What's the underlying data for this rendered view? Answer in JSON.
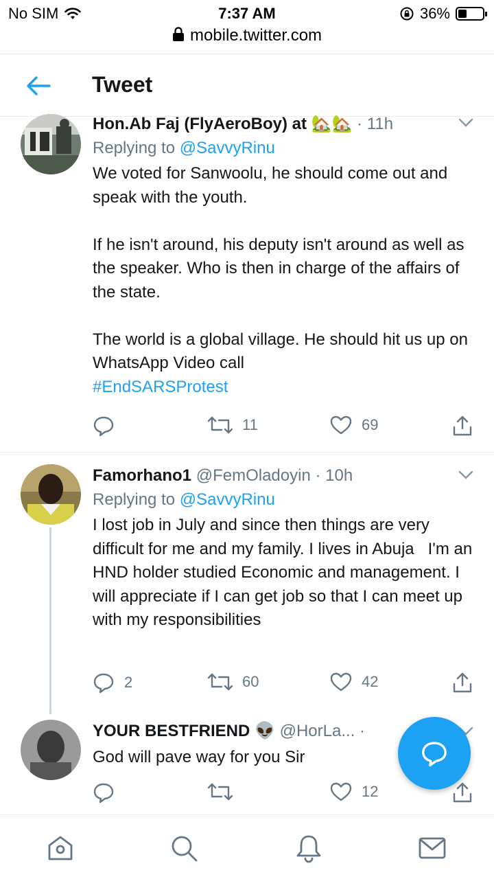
{
  "status_bar": {
    "carrier": "No SIM",
    "time": "7:37 AM",
    "battery_text": "36%",
    "battery_level": 0.36,
    "url": "mobile.twitter.com"
  },
  "header": {
    "title": "Tweet"
  },
  "tweets": [
    {
      "name": "Hon.Ab Faj (FlyAeroBoy) at",
      "emoji": "🏡🏡",
      "handle": "",
      "time": "· 11h",
      "replying_label": "Replying to",
      "replying_to": "@SavvyRinu",
      "text": "We voted for Sanwoolu, he should come out and speak with the youth.\n\nIf he isn't around, his deputy isn't around as well as the speaker. Who is then in charge of the affairs of the state.\n\nThe world is a global village. He should hit us up on WhatsApp Video call",
      "hashtag": "#EndSARSProtest",
      "replies": "",
      "retweets": "11",
      "likes": "69"
    },
    {
      "name": "Famorhano1",
      "handle": "@FemOladoyin",
      "time": "· 10h",
      "replying_label": "Replying to",
      "replying_to": "@SavvyRinu",
      "text": "I lost job in July and since then things are very difficult for me and my family. I lives in Abuja   I'm an HND holder studied Economic and management. I will appreciate if I can get job so that I can meet up with my responsibilities",
      "replies": "2",
      "retweets": "60",
      "likes": "42"
    },
    {
      "name": "YOUR BESTFRIEND",
      "emoji": "👽",
      "handle": "@HorLa...",
      "time": "·",
      "text": "God will pave way for you Sir",
      "replies": "",
      "retweets": "",
      "likes": "12"
    }
  ],
  "icons": {
    "wifi": "wifi-icon",
    "battery": "battery-icon",
    "rotation_lock": "rotation-lock-icon",
    "lock": "lock-icon",
    "back": "back-arrow-icon",
    "chevron": "chevron-down-icon",
    "reply": "reply-icon",
    "retweet": "retweet-icon",
    "like": "heart-icon",
    "share": "share-icon",
    "compose": "compose-reply-icon",
    "home": "home-icon",
    "search": "search-icon",
    "notifications": "bell-icon",
    "messages": "mail-icon"
  },
  "colors": {
    "accent": "#1da1f2",
    "text": "#14171a",
    "secondary": "#657786",
    "divider": "#e6ecf0"
  }
}
